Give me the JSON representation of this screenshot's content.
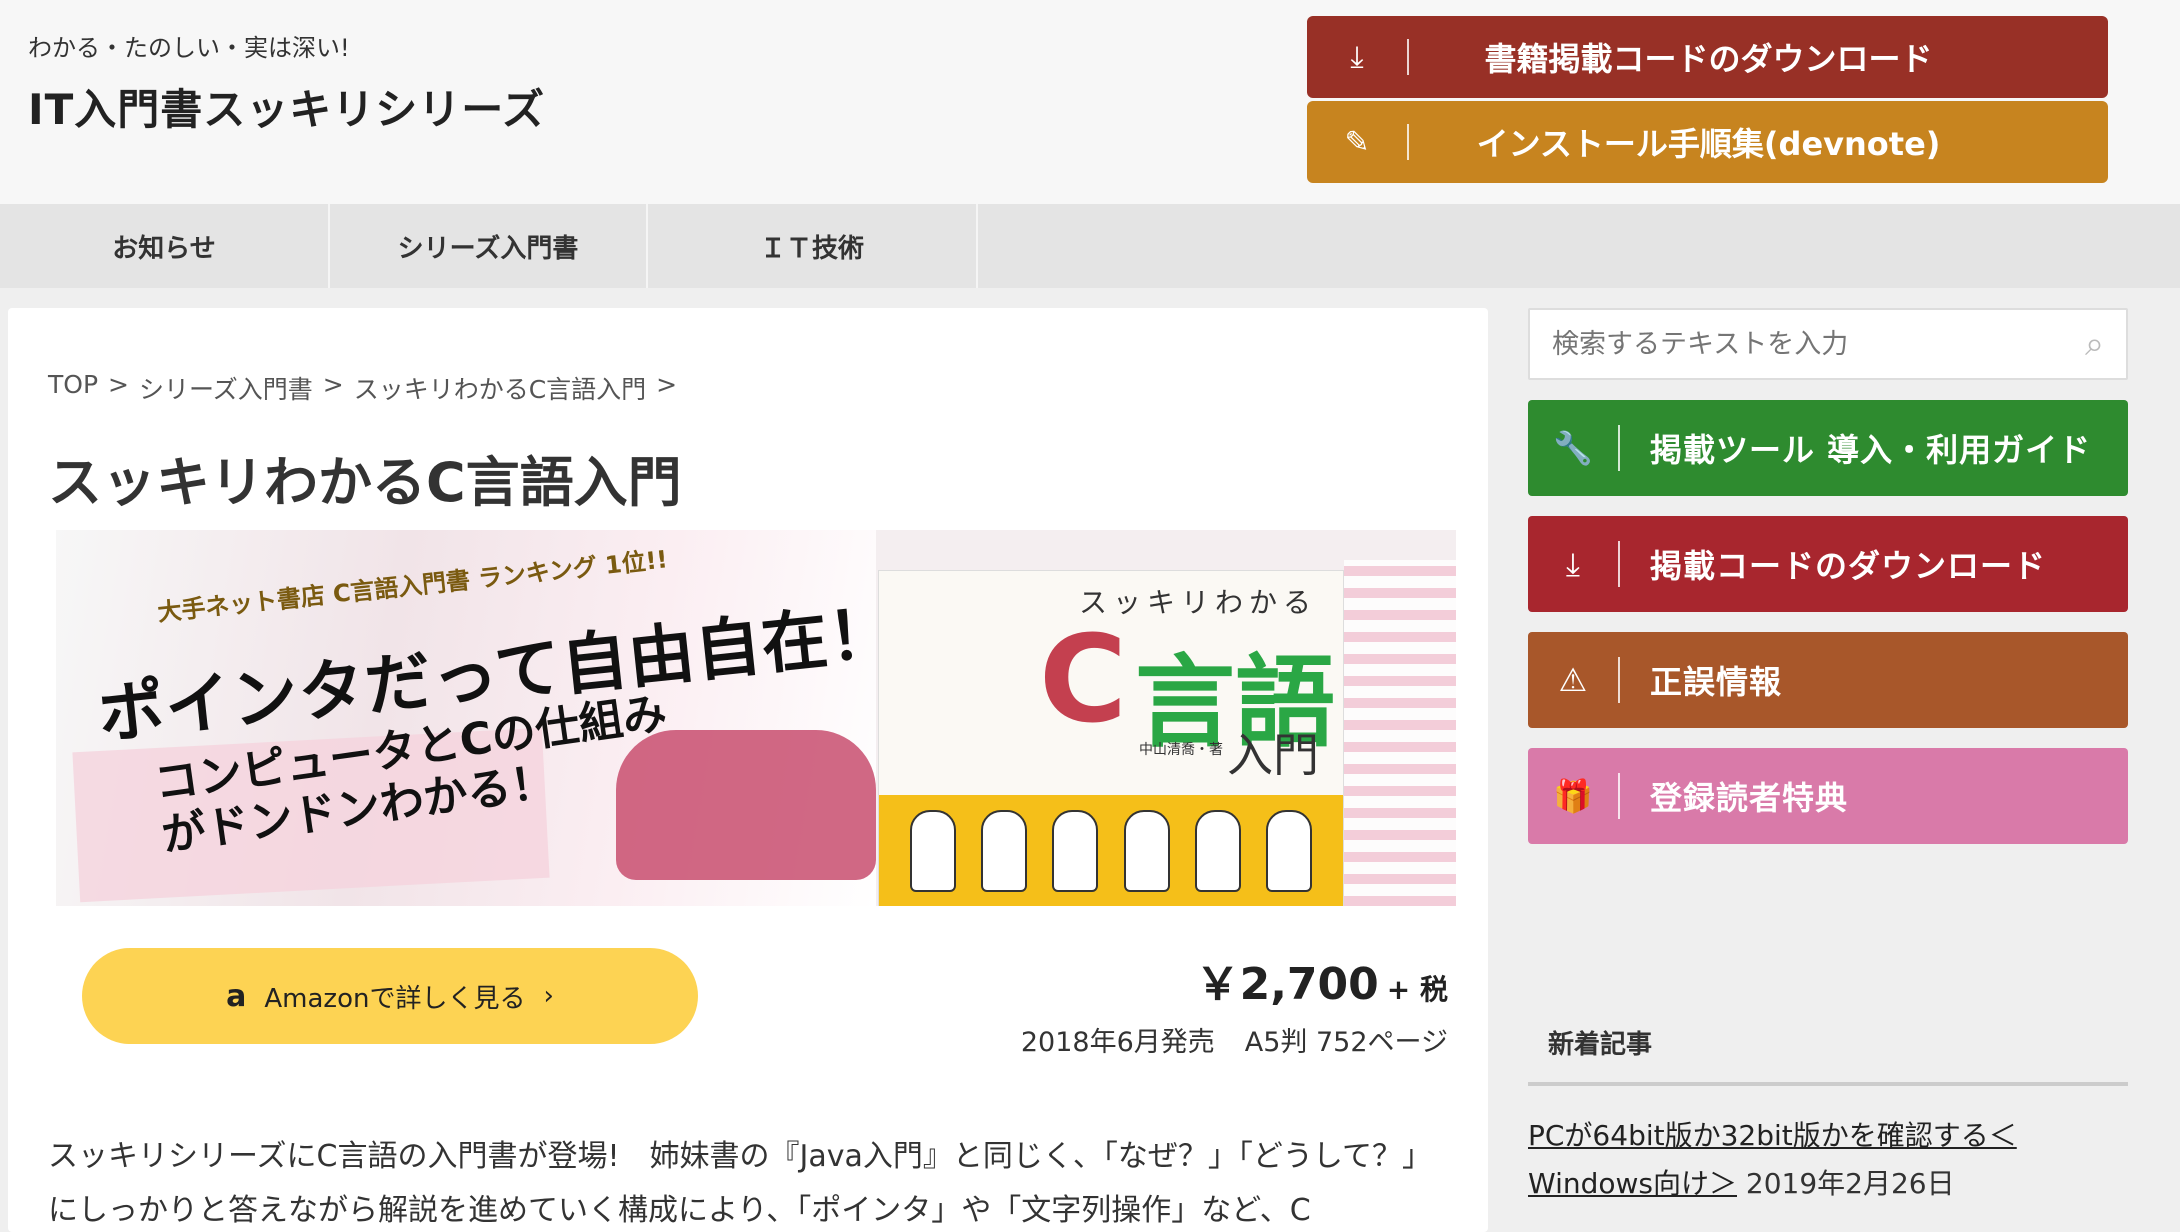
{
  "header": {
    "tagline": "わかる・たのしい・実は深い!",
    "title": "IT入門書スッキリシリーズ",
    "buttons": [
      {
        "label": "書籍掲載コードのダウンロード",
        "icon": "download-icon"
      },
      {
        "label": "インストール手順集(devnote)",
        "icon": "edit-icon"
      }
    ]
  },
  "nav": {
    "items": [
      "お知らせ",
      "シリーズ入門書",
      "ＩＴ技術"
    ]
  },
  "breadcrumb": [
    "TOP",
    ">",
    "シリーズ入門書",
    ">",
    "スッキリわかるC言語入門",
    ">"
  ],
  "page": {
    "title": "スッキリわかるC言語入門",
    "banner": {
      "rank": "大手ネット書店 C言語入門書 ランキング 1位!!",
      "headline": "ポインタだって自由自在！",
      "sub": "コンピュータとCの仕組みがドンドンわかる！",
      "book_series": "スッキリわかる",
      "book_c": "C",
      "book_lang": "言語",
      "book_intro": "入門",
      "book_author": "中山清喬・著"
    },
    "amazon_label": "Amazonで詳しく見る",
    "amazon_logo": "a",
    "amazon_arrow": "›",
    "price": "￥2,700",
    "tax": "+ 税",
    "release": "2018年6月発売",
    "spec": "A5判 752ページ",
    "description": "スッキリシリーズにC言語の入門書が登場!　姉妹書の『Java入門』と同じく、「なぜ？」「どうして？」にしっかりと答えながら解説を進めていく構成により、「ポインタ」や「文字列操作」など、C"
  },
  "sidebar": {
    "search_placeholder": "検索するテキストを入力",
    "buttons": [
      {
        "label": "掲載ツール 導入・利用ガイド",
        "icon": "wrench-icon"
      },
      {
        "label": "掲載コードのダウンロード",
        "icon": "download-icon"
      },
      {
        "label": "正誤情報",
        "icon": "warning-icon"
      },
      {
        "label": "登録読者特典",
        "icon": "gift-icon"
      }
    ],
    "news_heading": "新着記事",
    "news": [
      {
        "title": "PCが64bit版か32bit版かを確認する＜Windows向け＞",
        "date": "2019年2月26日"
      }
    ]
  },
  "colors": {
    "header_red": "#983026",
    "header_orange": "#c7841f",
    "side_green": "#2e8b2f",
    "side_red": "#a8262e",
    "side_brown": "#a8572a",
    "side_pink": "#d97aa9",
    "amazon_yellow": "#fdd353"
  }
}
